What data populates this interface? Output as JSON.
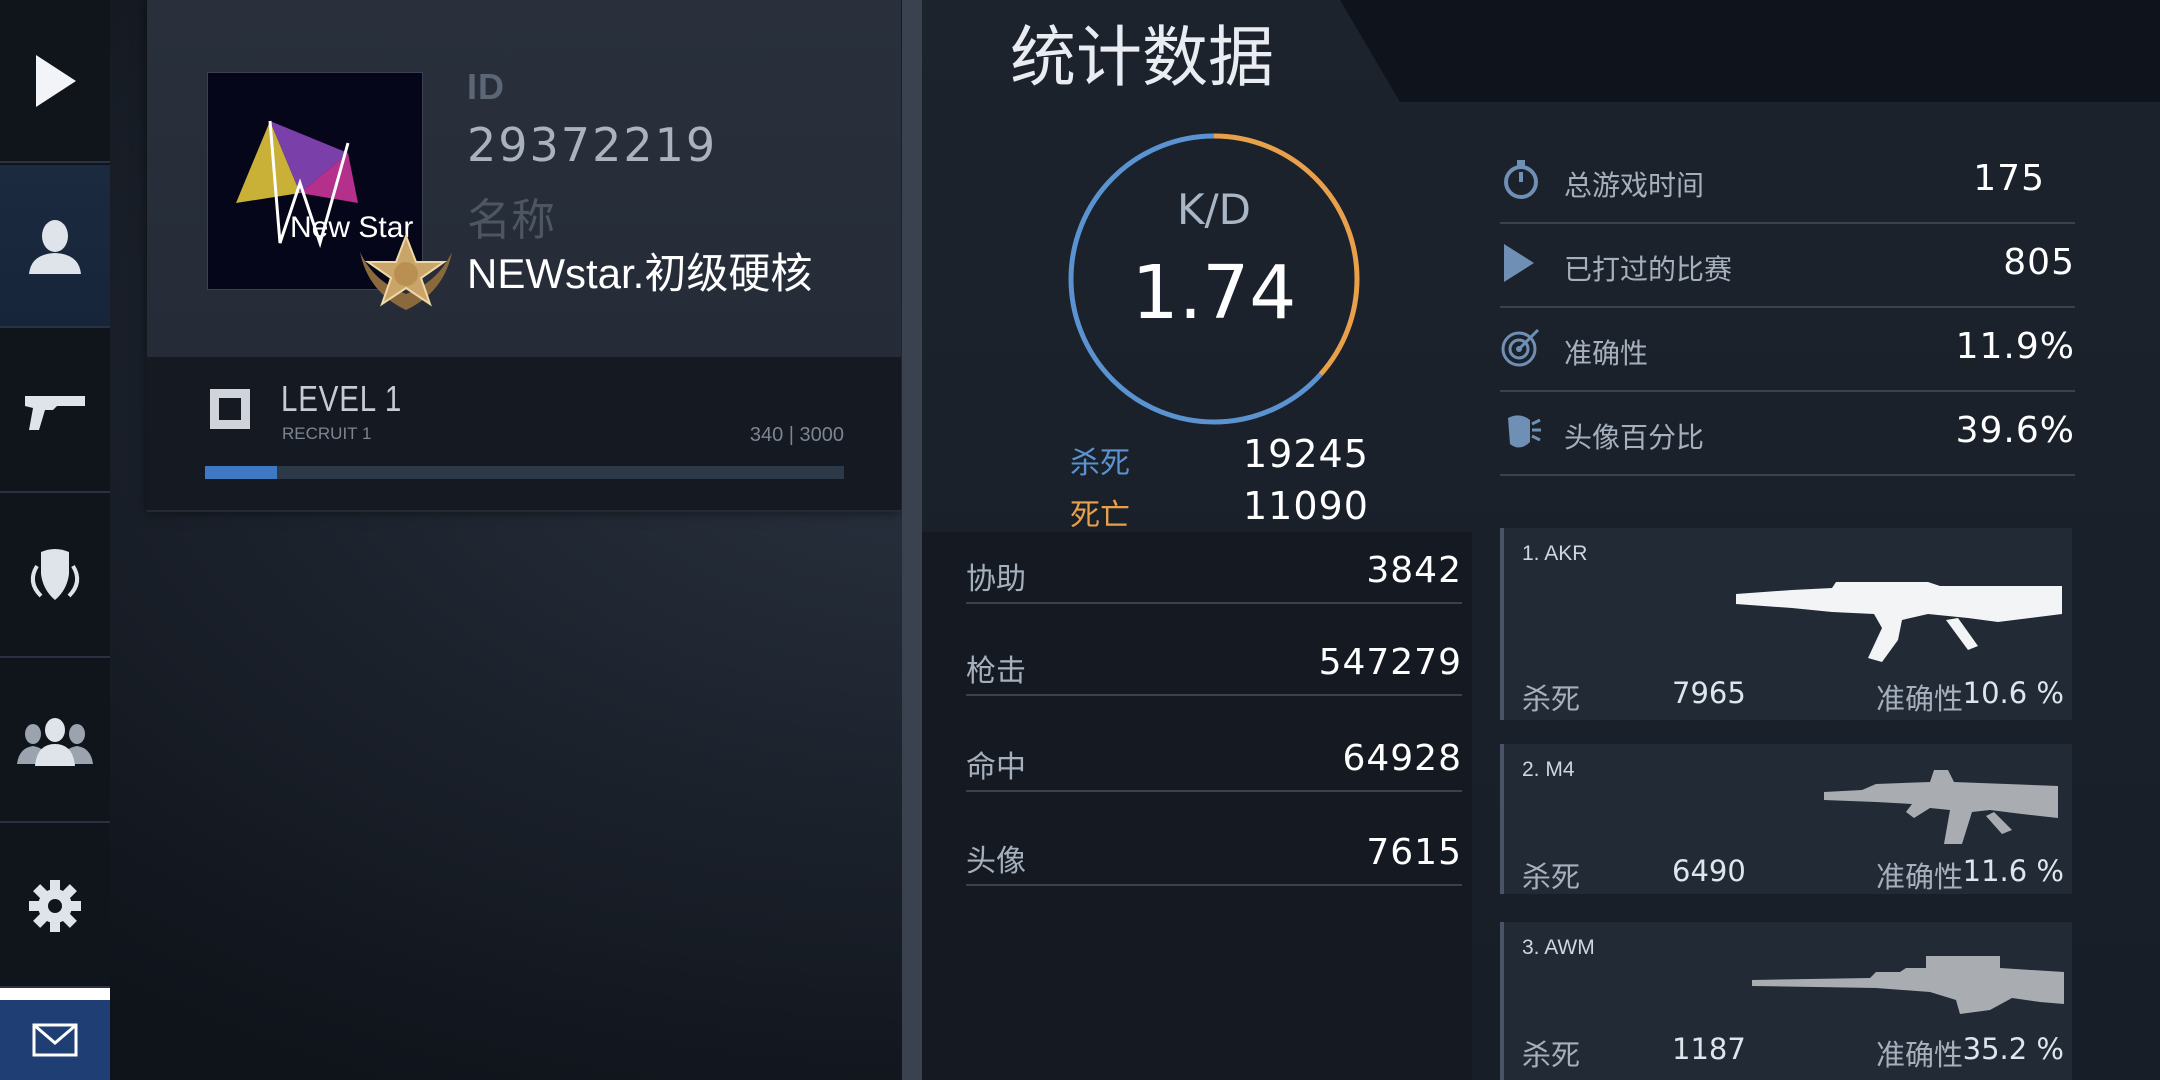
{
  "nav": {
    "items": [
      {
        "name": "play-icon"
      },
      {
        "name": "profile-icon"
      },
      {
        "name": "pistol-icon"
      },
      {
        "name": "shield-emblem-icon"
      },
      {
        "name": "group-icon"
      },
      {
        "name": "gear-icon"
      },
      {
        "name": "mail-icon"
      }
    ],
    "active_index": 1
  },
  "profile": {
    "avatar_text": "New Star",
    "id_label": "ID",
    "id_value": "29372219",
    "name_label": "名称",
    "name_value": "NEWstar.初级硬核",
    "level_title": "LEVEL 1",
    "level_sub": "RECRUIT 1",
    "xp_text": "340 | 3000",
    "xp_current": 340,
    "xp_max": 3000
  },
  "stats": {
    "title": "统计数据",
    "kd_label": "K/D",
    "kd_value": "1.74",
    "kills_label": "杀死",
    "kills_value": "19245",
    "deaths_label": "死亡",
    "deaths_value": "11090",
    "kd_ring_kill_fraction": 0.634,
    "colors": {
      "kills": "#5a93cf",
      "deaths": "#e8a04a"
    },
    "secondary": [
      {
        "label": "协助",
        "value": "3842"
      },
      {
        "label": "枪击",
        "value": "547279"
      },
      {
        "label": "命中",
        "value": "64928"
      },
      {
        "label": "头像",
        "value": "7615"
      }
    ],
    "summary": [
      {
        "icon": "stopwatch-icon",
        "label": "总游戏时间",
        "value": "175"
      },
      {
        "icon": "play-triangle-icon",
        "label": "已打过的比赛",
        "value": "805"
      },
      {
        "icon": "target-icon",
        "label": "准确性",
        "value": "11.9%"
      },
      {
        "icon": "headshot-icon",
        "label": "头像百分比",
        "value": "39.6%"
      }
    ],
    "weapons": [
      {
        "name": "1. AKR",
        "kills_label": "杀死",
        "kills": "7965",
        "acc_label": "准确性",
        "accuracy": "10.6 %"
      },
      {
        "name": "2. M4",
        "kills_label": "杀死",
        "kills": "6490",
        "acc_label": "准确性",
        "accuracy": "11.6 %"
      },
      {
        "name": "3. AWM",
        "kills_label": "杀死",
        "kills": "1187",
        "acc_label": "准确性",
        "accuracy": "35.2 %"
      }
    ]
  }
}
